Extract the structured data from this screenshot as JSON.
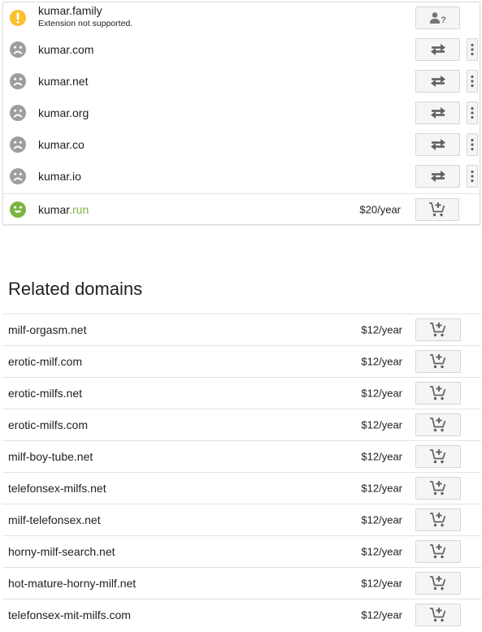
{
  "results": [
    {
      "sld": "kumar",
      "tld": ".family",
      "sublabel": "Extension not supported.",
      "status": "warning",
      "action": "contact-icon",
      "menu": false,
      "price": "",
      "tld_color": "#212121"
    },
    {
      "sld": "kumar",
      "tld": ".com",
      "sublabel": "",
      "status": "taken",
      "action": "transfer-icon",
      "menu": true,
      "price": ""
    },
    {
      "sld": "kumar",
      "tld": ".net",
      "sublabel": "",
      "status": "taken",
      "action": "transfer-icon",
      "menu": true,
      "price": ""
    },
    {
      "sld": "kumar",
      "tld": ".org",
      "sublabel": "",
      "status": "taken",
      "action": "transfer-icon",
      "menu": true,
      "price": ""
    },
    {
      "sld": "kumar",
      "tld": ".co",
      "sublabel": "",
      "status": "taken",
      "action": "transfer-icon",
      "menu": true,
      "price": ""
    },
    {
      "sld": "kumar",
      "tld": ".io",
      "sublabel": "",
      "status": "taken",
      "action": "transfer-icon",
      "menu": true,
      "price": ""
    },
    {
      "sld": "kumar",
      "tld": ".run",
      "sublabel": "",
      "status": "available",
      "action": "add-to-cart-icon",
      "menu": false,
      "price": "$20/year"
    }
  ],
  "related": {
    "title": "Related domains",
    "items": [
      {
        "name": "milf-orgasm.net",
        "price": "$12/year"
      },
      {
        "name": "erotic-milf.com",
        "price": "$12/year"
      },
      {
        "name": "erotic-milfs.net",
        "price": "$12/year"
      },
      {
        "name": "erotic-milfs.com",
        "price": "$12/year"
      },
      {
        "name": "milf-boy-tube.net",
        "price": "$12/year"
      },
      {
        "name": "telefonsex-milfs.net",
        "price": "$12/year"
      },
      {
        "name": "milf-telefonsex.net",
        "price": "$12/year"
      },
      {
        "name": "horny-milf-search.net",
        "price": "$12/year"
      },
      {
        "name": "hot-mature-horny-milf.net",
        "price": "$12/year"
      },
      {
        "name": "telefonsex-mit-milfs.com",
        "price": "$12/year"
      }
    ]
  },
  "colors": {
    "warning": "#fbc02d",
    "taken": "#9e9e9e",
    "available": "#7cb342",
    "available_tld": "#7cb342"
  }
}
